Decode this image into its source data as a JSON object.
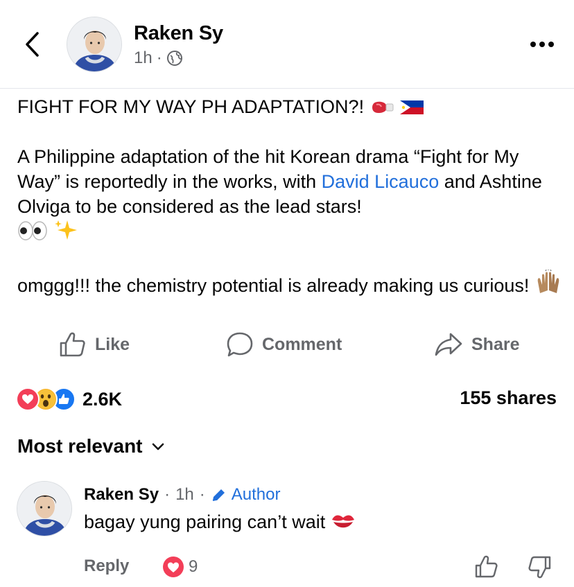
{
  "header": {
    "author_name": "Raken Sy",
    "time": "1h",
    "separator": "·",
    "back_icon": "chevron-left-icon",
    "privacy_icon": "globe-icon",
    "more_icon": "more-horizontal-icon"
  },
  "post": {
    "line1": "FIGHT FOR MY WAY PH ADAPTATION?!",
    "para2_before_link": "A Philippine adaptation of the hit Korean drama “Fight for My Way” is reportedly in the works, with ",
    "para2_link": "David Licauco",
    "para2_after_link": " and Ashtine Olviga to be considered as the lead stars!",
    "para3": "omggg!!! the chemistry potential is already making us curious!"
  },
  "actions": {
    "like_label": "Like",
    "comment_label": "Comment",
    "share_label": "Share"
  },
  "stats": {
    "reaction_count": "2.6K",
    "shares": "155 shares"
  },
  "sort": {
    "label": "Most relevant"
  },
  "comment": {
    "author": "Raken Sy",
    "time": "1h",
    "badge": "Author",
    "text": "bagay yung pairing can’t wait",
    "reply_label": "Reply",
    "reaction_count": "9"
  },
  "colors": {
    "link": "#216fdb",
    "muted": "#65676b",
    "love": "#f33e58",
    "like": "#1877f2",
    "wow": "#f7b125"
  }
}
